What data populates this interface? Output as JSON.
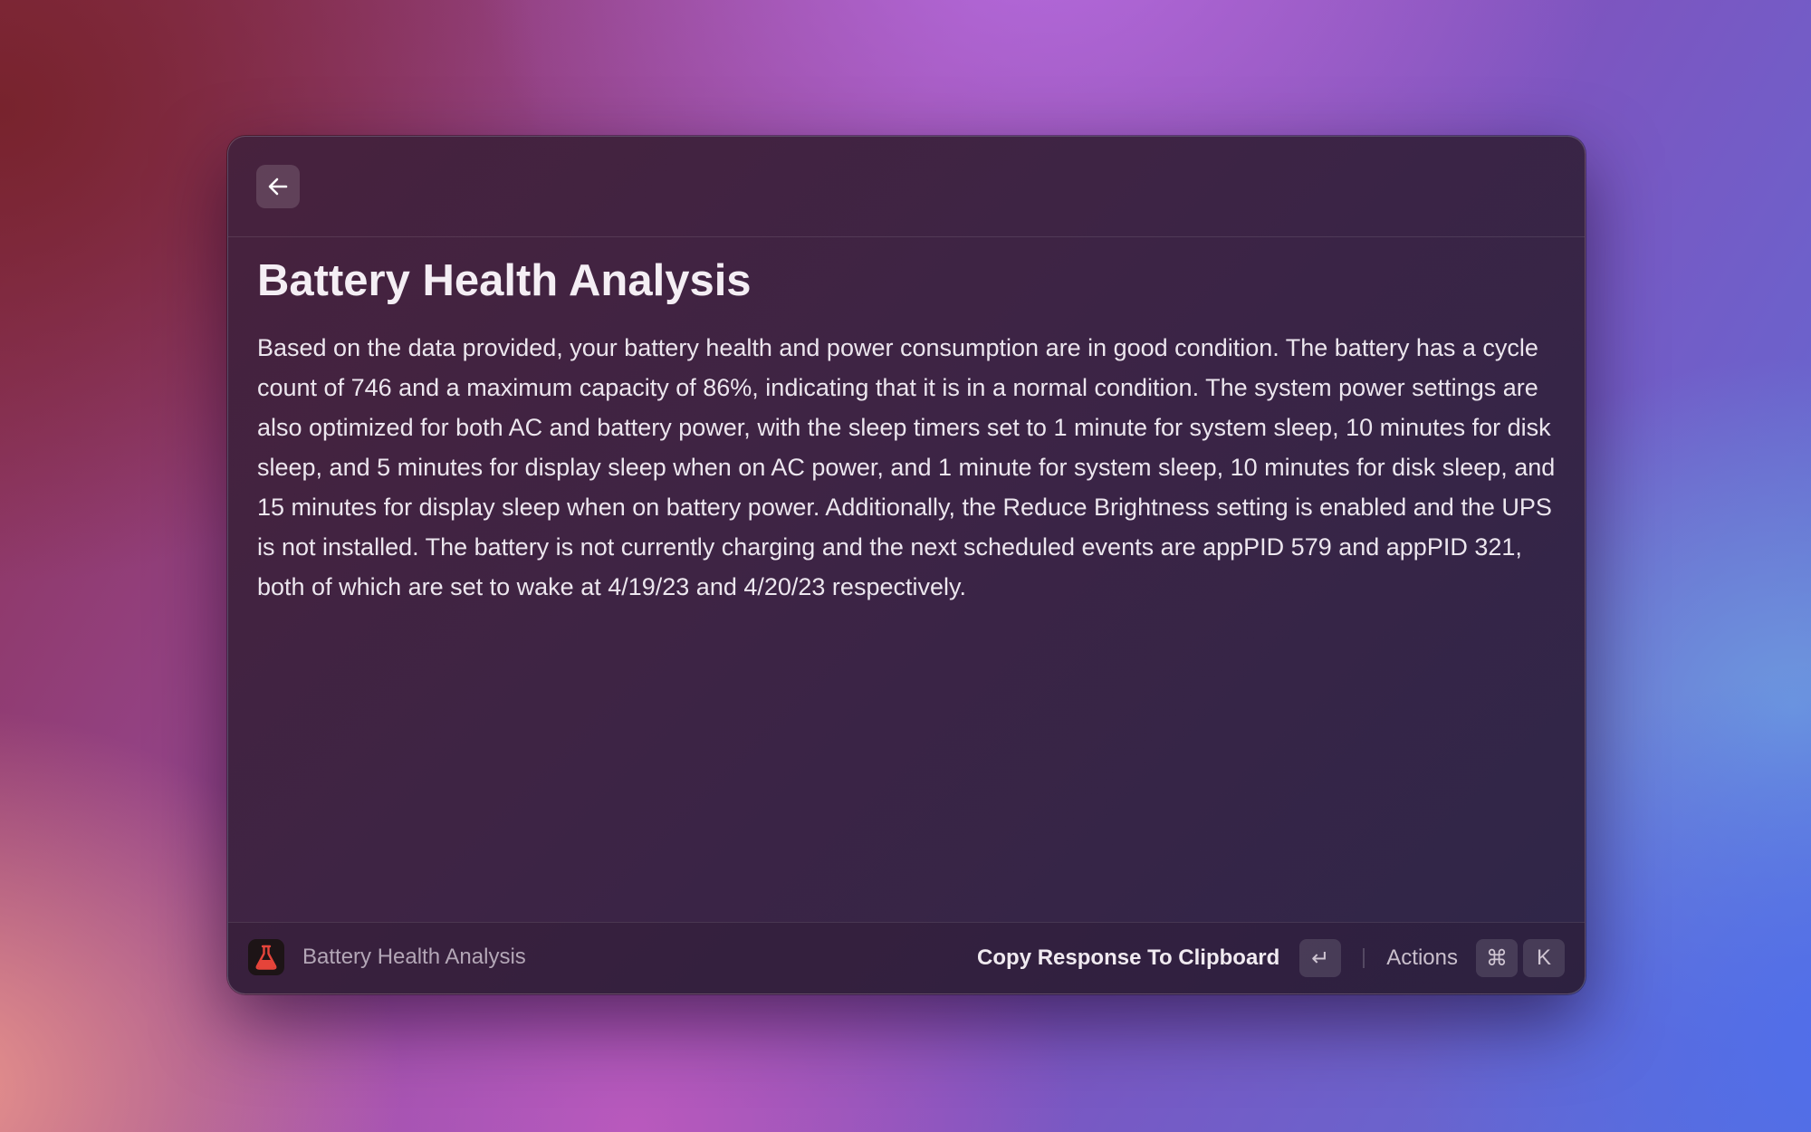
{
  "header": {
    "back_icon": "arrow-left-icon"
  },
  "main": {
    "title": "Battery Health Analysis",
    "body": "Based on the data provided, your battery health and power consumption are in good condition. The battery has a cycle count of 746 and a maximum capacity of 86%, indicating that it is in a normal condition. The system power settings are also optimized for both AC and battery power, with the sleep timers set to 1 minute for system sleep, 10 minutes for disk sleep, and 5 minutes for display sleep when on AC power, and 1 minute for system sleep, 10 minutes for disk sleep, and 15 minutes for display sleep when on battery power. Additionally, the Reduce Brightness setting is enabled and the UPS is not installed. The battery is not currently charging and the next scheduled events are appPID 579 and appPID 321, both of which are set to wake at 4/19/23 and 4/20/23 respectively."
  },
  "footer": {
    "app_icon": "flask-icon",
    "title": "Battery Health Analysis",
    "primary_action": "Copy Response To Clipboard",
    "primary_key": "↵",
    "actions_label": "Actions",
    "actions_keys": [
      "⌘",
      "K"
    ]
  },
  "colors": {
    "window_bg": "#3d2445",
    "accent_icon": "#e5443a"
  }
}
